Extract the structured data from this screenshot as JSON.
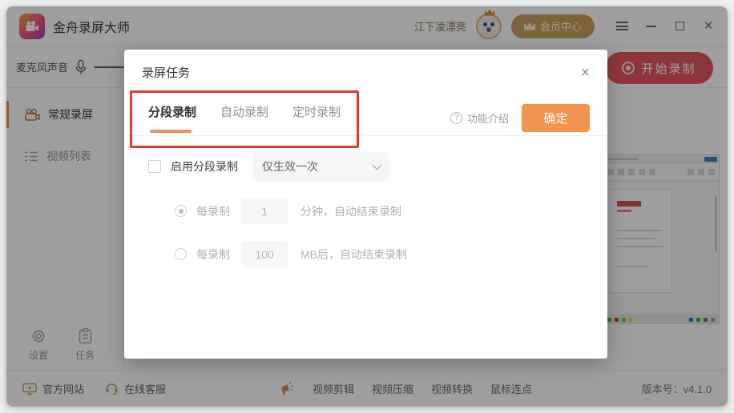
{
  "titlebar": {
    "app_title": "金舟录屏大师",
    "username": "江下凌漂亮",
    "member_center_label": "会员中心",
    "close_glyph": "×"
  },
  "sidebar": {
    "mic_label": "麦克风声音",
    "nav_regular": "常规录屏",
    "nav_video_list": "视频列表",
    "settings_label": "设置",
    "tasks_label": "任务"
  },
  "content": {
    "start_button_label": "开始录制"
  },
  "modal": {
    "title": "录屏任务",
    "close_glyph": "×",
    "tabs": [
      {
        "label": "分段录制",
        "active": true
      },
      {
        "label": "自动录制",
        "active": false
      },
      {
        "label": "定时录制",
        "active": false
      }
    ],
    "help_glyph": "?",
    "feature_intro_label": "功能介绍",
    "confirm_label": "确定",
    "form": {
      "enable_checkbox_label": "启用分段录制",
      "enable_checked": false,
      "mode_dropdown_value": "仅生效一次",
      "minute_rule": {
        "prefix": "每录制",
        "value": "1",
        "suffix": "分钟，自动结束录制",
        "selected": true
      },
      "size_rule": {
        "prefix": "每录制",
        "value": "100",
        "suffix": "MB后，自动结束录制",
        "selected": false
      }
    }
  },
  "footer": {
    "official_site": "官方网站",
    "online_support": "在线客服",
    "promo_links": [
      "视频剪辑",
      "视频压缩",
      "视频转换",
      "鼠标连点"
    ],
    "version": "版本号：v4.1.0"
  },
  "colors": {
    "accent_orange": "#f0915a",
    "record_red": "#e4585c",
    "annotation_red": "#e23a2c",
    "member_gold": "#c9a062"
  },
  "icons": {
    "app-logo-icon": "video-camera on orange-purple gradient",
    "mic-icon": "microphone",
    "camera-icon": "recorder camera",
    "list-icon": "list lines",
    "gear-icon": "settings gear",
    "clipboard-icon": "task clipboard",
    "record-dot-icon": "record circle",
    "crown-icon": "member crown",
    "monitor-icon": "official website monitor",
    "headset-icon": "online support headset",
    "megaphone-icon": "promo megaphone"
  }
}
